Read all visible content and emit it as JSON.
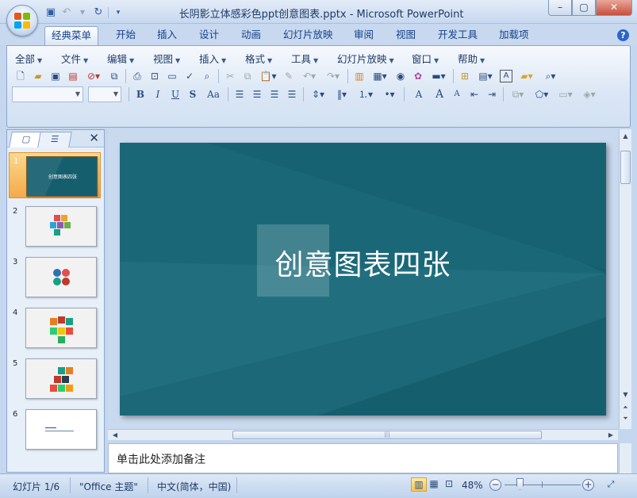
{
  "window": {
    "title": "长阴影立体感彩色ppt创意图表.pptx - Microsoft PowerPoint",
    "min_label": "▭",
    "restore_label": "▢",
    "close_label": "✕"
  },
  "qat": {
    "save_icon": "save-icon",
    "undo_icon": "undo-icon",
    "redo_icon": "redo-icon",
    "customize_icon": "chevron-down-icon"
  },
  "tabs": [
    {
      "label": "经典菜单",
      "active": true
    },
    {
      "label": "开始"
    },
    {
      "label": "插入"
    },
    {
      "label": "设计"
    },
    {
      "label": "动画"
    },
    {
      "label": "幻灯片放映"
    },
    {
      "label": "审阅"
    },
    {
      "label": "视图"
    },
    {
      "label": "开发工具"
    },
    {
      "label": "加载项"
    }
  ],
  "menu": [
    {
      "label": "全部"
    },
    {
      "label": "文件"
    },
    {
      "label": "编辑"
    },
    {
      "label": "视图"
    },
    {
      "label": "插入"
    },
    {
      "label": "格式"
    },
    {
      "label": "工具"
    },
    {
      "label": "幻灯片放映"
    },
    {
      "label": "窗口"
    },
    {
      "label": "帮助"
    }
  ],
  "format": {
    "bold": "B",
    "italic": "I",
    "underline": "U",
    "strike": "S",
    "case": "Aa",
    "font_color": "A",
    "grow": "A",
    "shrink": "A"
  },
  "thumbnails": [
    {
      "num": "1",
      "active": true,
      "title": "创意图表四张"
    },
    {
      "num": "2"
    },
    {
      "num": "3"
    },
    {
      "num": "4"
    },
    {
      "num": "5"
    },
    {
      "num": "6"
    }
  ],
  "slide": {
    "title": "创意图表四张",
    "bg_color": "#155e6e"
  },
  "notes": {
    "placeholder": "单击此处添加备注"
  },
  "status": {
    "slide_info": "幻灯片 1/6",
    "theme": "\"Office 主题\"",
    "language": "中文(简体，中国)",
    "zoom": "48%"
  },
  "colors": {
    "accent": "#15428b",
    "active_tab_highlight": "#f5a94a"
  }
}
